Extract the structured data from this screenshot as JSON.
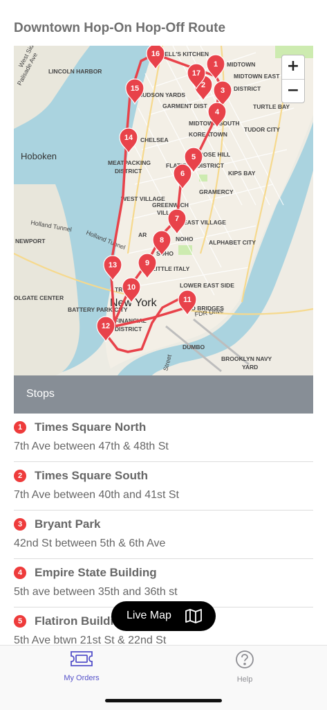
{
  "page": {
    "title": "Downtown Hop-On Hop-Off Route"
  },
  "map": {
    "zoom_in_label": "+",
    "zoom_out_label": "−",
    "labels": {
      "west_side": "West Side",
      "palisade_ave": "Palisade Ave",
      "lincoln_harbor": "LINCOLN HARBOR",
      "hells_kitchen": "HELL'S KITCHEN",
      "midtown": "MIDTOWN",
      "midtown_east": "MIDTOWN EAST",
      "district": "DISTRICT",
      "hudson_yards": "HUDSON YARDS",
      "garment_district": "GARMENT DIST",
      "turtle_bay": "TURTLE BAY",
      "midtown_south": "MIDTOWN SOUTH",
      "koreatown": "KOREATOWN",
      "tudor_city": "TUDOR CITY",
      "chelsea": "CHELSEA",
      "hoboken": "Hoboken",
      "rose_hill": "ROSE HILL",
      "meatpacking": "MEATPACKING",
      "meatpacking_district": "DISTRICT",
      "flatiron": "FLATIRON DISTRICT",
      "kips_bay": "KIPS BAY",
      "gramercy": "GRAMERCY",
      "west_village": "WEST VILLAGE",
      "greenwich_village": "GREENWICH",
      "village": "VILLAGE",
      "east_village": "EAST VILLAGE",
      "holland_tunnel": "Holland Tunnel",
      "holland_tunnel_2": "Holland Tunnel",
      "newport": "NEWPORT",
      "noho": "NOHO",
      "soho": "SOHO",
      "alphabet_city": "ALPHABET CITY",
      "little_italy": "LITTLE ITALY",
      "lower_east_side": "LOWER EAST SIDE",
      "colgate_center": "OLGATE CENTER",
      "new_york": "New York",
      "battery_park_city": "BATTERY PARK CITY",
      "tribeca": "TRI",
      "financial_district": "FINANCIAL",
      "financial_district_2": "DISTRICT",
      "two_bridges": "TWO BRIDGES",
      "fdr_drive": "FDR Drive",
      "dumbo": "DUMBO",
      "brooklyn_navy_yard": "BROOKLYN NAVY",
      "navy_yard": "YARD",
      "street": "Street",
      "ar": "AR"
    },
    "markers": [
      "1",
      "2",
      "3",
      "4",
      "5",
      "6",
      "7",
      "8",
      "9",
      "10",
      "11",
      "12",
      "13",
      "14",
      "15",
      "16",
      "17"
    ],
    "route_color": "#e8424a"
  },
  "stops_header": "Stops",
  "stops": [
    {
      "num": "1",
      "name": "Times Square North",
      "address": "7th Ave between 47th & 48th St"
    },
    {
      "num": "2",
      "name": "Times Square South",
      "address": "7th Ave between 40th and 41st St"
    },
    {
      "num": "3",
      "name": "Bryant Park",
      "address": "42nd St between 5th & 6th Ave"
    },
    {
      "num": "4",
      "name": "Empire State Building",
      "address": "5th ave between 35th and 36th st"
    },
    {
      "num": "5",
      "name": "Flatiron Building",
      "address": "5th Ave btwn 21st St & 22nd St"
    }
  ],
  "live_map_button": {
    "label": "Live Map",
    "icon": "map-icon"
  },
  "tab_bar": {
    "orders": {
      "label": "My Orders",
      "icon": "ticket-icon",
      "color": "#5450c9"
    },
    "help": {
      "label": "Help",
      "icon": "help-circle-icon",
      "color": "#8e8e93"
    }
  }
}
